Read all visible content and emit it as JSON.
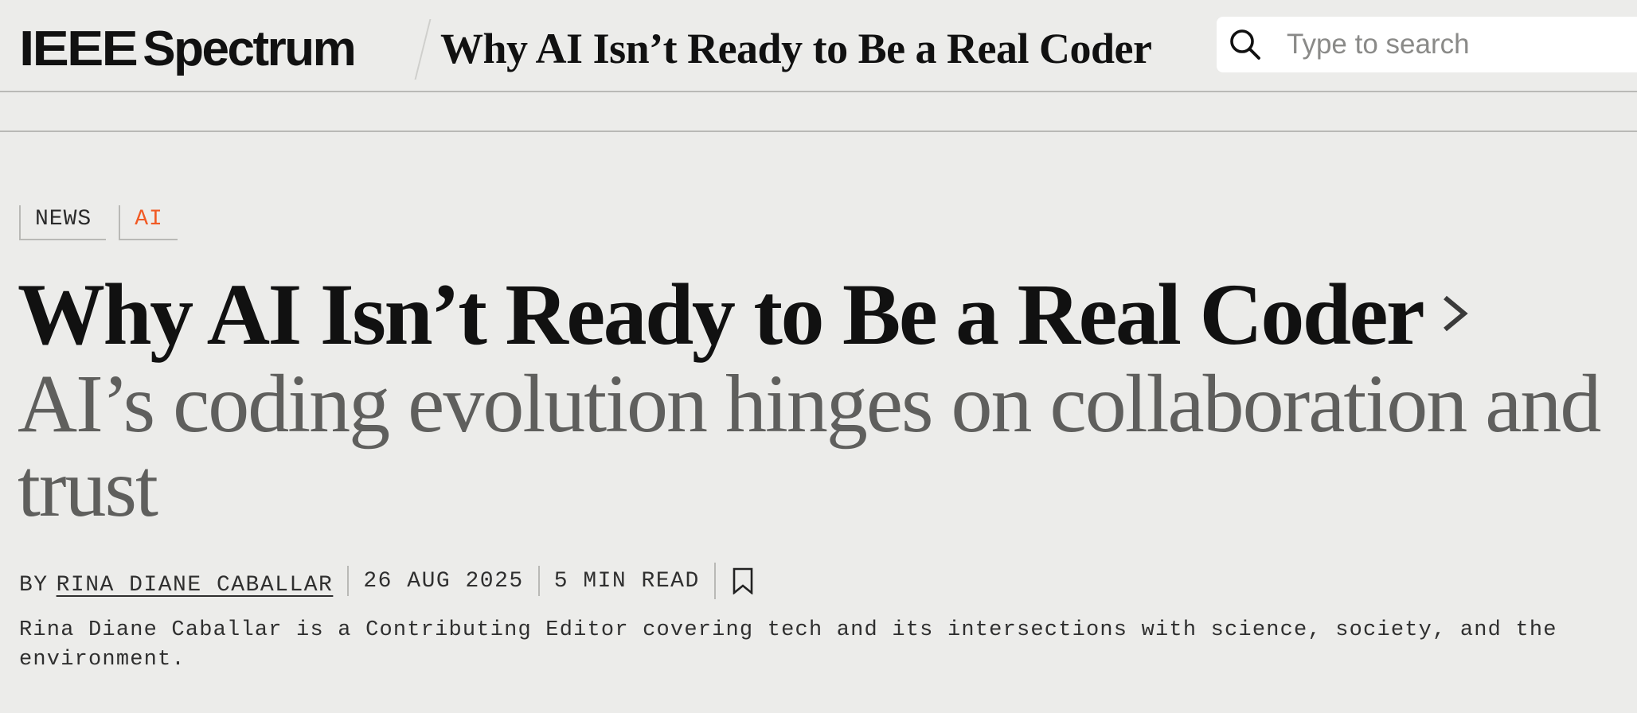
{
  "header": {
    "logo_part1": "IEEE",
    "logo_part2": "Spectrum",
    "article_title": "Why AI Isn’t Ready to Be a Real Coder"
  },
  "search": {
    "placeholder": "Type to search",
    "value": "",
    "icon": "search-icon"
  },
  "tags": [
    {
      "label": "NEWS",
      "color": "#2a2a2a"
    },
    {
      "label": "AI",
      "color": "#f15a24"
    }
  ],
  "article": {
    "headline": "Why AI Isn’t Ready to Be a Real Coder",
    "headline_icon": "chevron-right-icon",
    "dek": "AI’s coding evolution hinges on collaboration and trust"
  },
  "byline": {
    "by_label": "BY",
    "author": "RINA DIANE CABALLAR",
    "date": "26 AUG 2025",
    "read_time": "5 MIN READ",
    "bookmark_icon": "bookmark-icon"
  },
  "bio": "Rina Diane Caballar is a Contributing Editor covering tech and its intersections with science, society, and the environment.",
  "colors": {
    "background": "#ececea",
    "accent": "#f15a24",
    "text": "#111111",
    "dek": "#5f5f5d",
    "rule": "#b9b9b6"
  }
}
